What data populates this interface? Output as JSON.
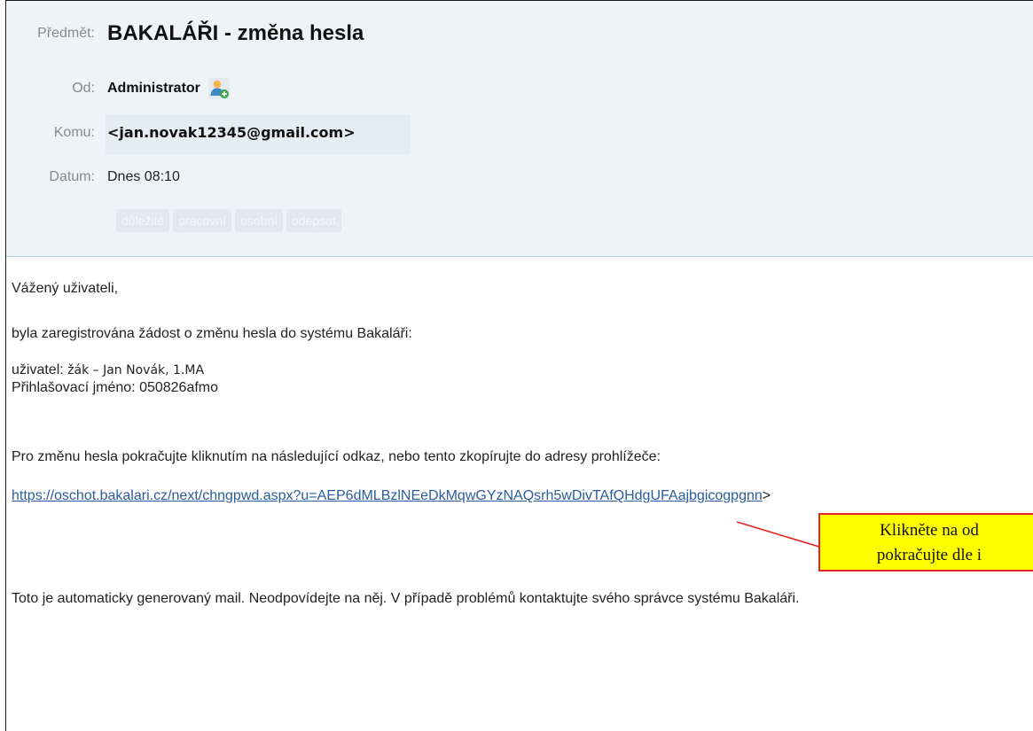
{
  "header": {
    "subject_label": "Předmět:",
    "subject": "BAKALÁŘI - změna hesla",
    "from_label": "Od:",
    "from": "Administrator",
    "to_label": "Komu:",
    "to": "<jan.novak12345@gmail.com>",
    "date_label": "Datum:",
    "date": "Dnes 08:10",
    "tags": [
      "důležité",
      "pracovní",
      "osobní",
      "odepsat"
    ]
  },
  "body": {
    "greeting": "Vážený uživateli,",
    "intro": "byla zaregistrována žádost o změnu hesla do systému Bakaláři:",
    "user_label": "uživatel:",
    "user_value": "žák – Jan Novák, 1.MA",
    "login_line": "Přihlašovací jméno: 050826afmo",
    "instruction": "Pro změnu hesla pokračujte kliknutím na následující odkaz, nebo tento zkopírujte do adresy prohlížeče:",
    "link": "https://oschot.bakalari.cz/next/chngpwd.aspx?u=AEP6dMLBzlNEeDkMqwGYzNAQsrh5wDivTAfQHdgUFAajbgicogpgnn",
    "link_suffix": ">",
    "footer": "Toto je automaticky generovaný mail. Neodpovídejte na něj. V případě problémů kontaktujte svého správce systému Bakaláři."
  },
  "callout": {
    "line1": "Klikněte na od",
    "line2": "pokračujte dle i"
  },
  "colors": {
    "header_bg": "#eef3f6",
    "link": "#2b5c9e",
    "callout_bg": "#ffff00",
    "callout_border": "#e52420"
  }
}
